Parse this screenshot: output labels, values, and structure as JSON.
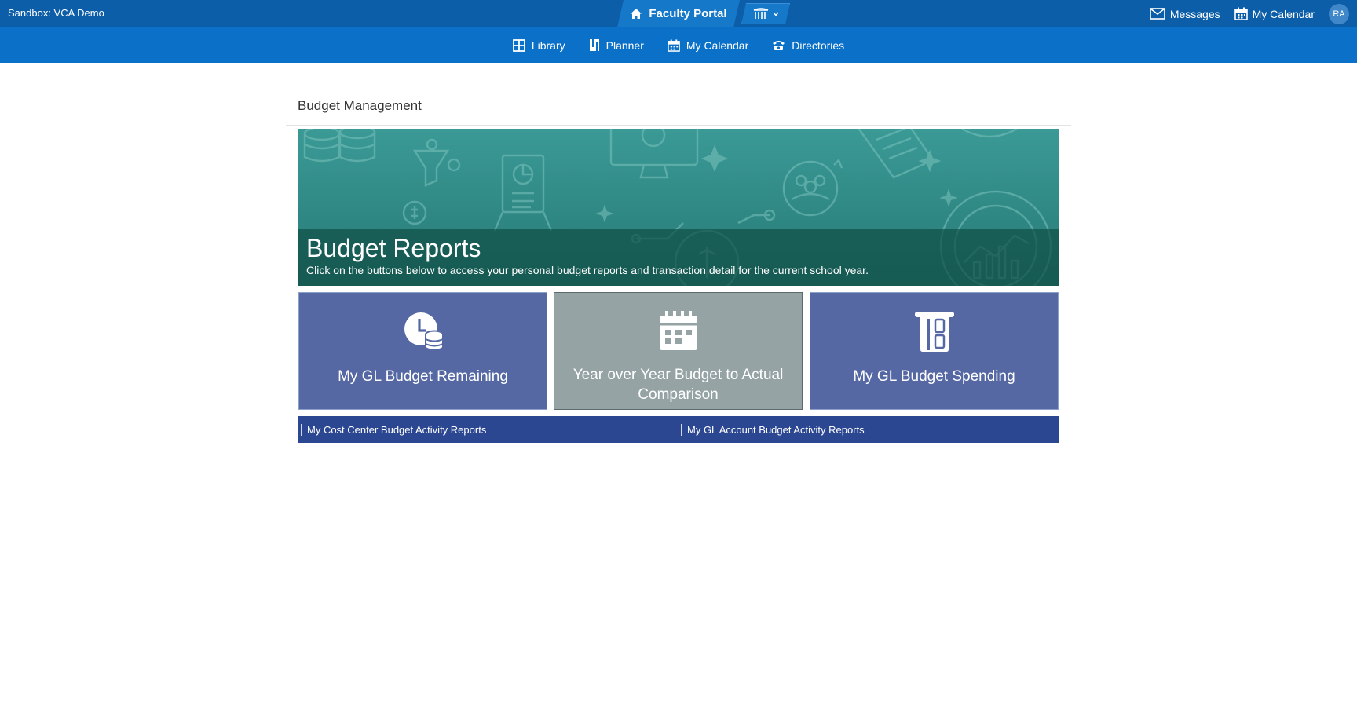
{
  "topbar": {
    "sandbox_label": "Sandbox: VCA Demo",
    "portal_label": "Faculty Portal",
    "messages_label": "Messages",
    "calendar_label": "My Calendar",
    "avatar_initials": "RA"
  },
  "nav": {
    "items": [
      {
        "label": "Library",
        "icon": "grid-icon"
      },
      {
        "label": "Planner",
        "icon": "planner-icon"
      },
      {
        "label": "My Calendar",
        "icon": "calendar-icon"
      },
      {
        "label": "Directories",
        "icon": "phone-icon"
      }
    ]
  },
  "page": {
    "title": "Budget Management"
  },
  "banner": {
    "title": "Budget Reports",
    "subtitle": "Click on the buttons below to access your personal budget reports and transaction detail for the current school year."
  },
  "tiles": [
    {
      "label": "My GL Budget Remaining",
      "icon": "clock-coins-icon"
    },
    {
      "label": "Year over Year Budget to Actual Comparison",
      "icon": "calendar-icon"
    },
    {
      "label": "My GL Budget Spending",
      "icon": "atm-card-icon"
    }
  ],
  "links": [
    {
      "label": "My Cost Center Budget Activity Reports"
    },
    {
      "label": "My GL Account Budget Activity Reports"
    }
  ],
  "colors": {
    "topbar": "#0d5ea8",
    "navbar": "#0a70c8",
    "banner_teal": "#2e8682",
    "tile_blue": "#5568a3",
    "tile_gray": "#95a3a4",
    "linkbar": "#2c4791"
  }
}
